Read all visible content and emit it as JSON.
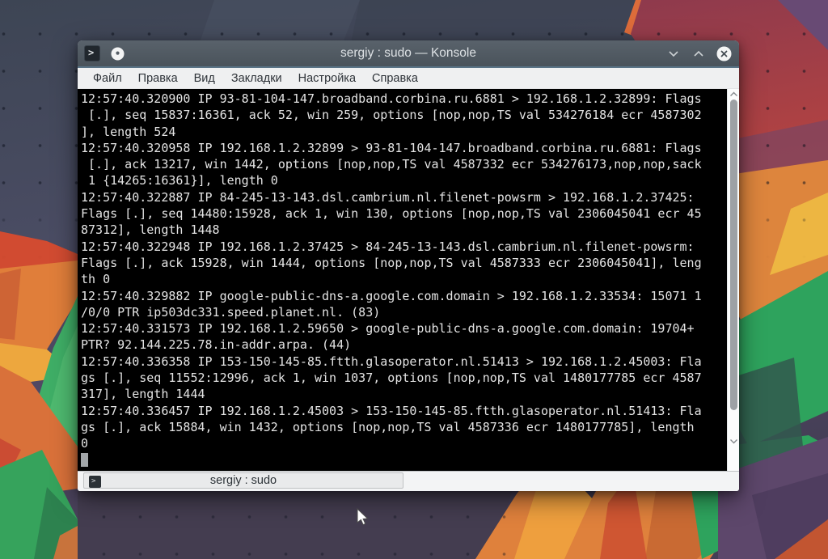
{
  "titlebar": {
    "title": "sergiy : sudo — Konsole"
  },
  "menubar": {
    "items": [
      "Файл",
      "Правка",
      "Вид",
      "Закладки",
      "Настройка",
      "Справка"
    ]
  },
  "terminal": {
    "lines": [
      "12:57:40.320900 IP 93-81-104-147.broadband.corbina.ru.6881 > 192.168.1.2.32899: Flags",
      " [.], seq 15837:16361, ack 52, win 259, options [nop,nop,TS val 534276184 ecr 4587302",
      "], length 524",
      "12:57:40.320958 IP 192.168.1.2.32899 > 93-81-104-147.broadband.corbina.ru.6881: Flags",
      " [.], ack 13217, win 1442, options [nop,nop,TS val 4587332 ecr 534276173,nop,nop,sack",
      " 1 {14265:16361}], length 0",
      "12:57:40.322887 IP 84-245-13-143.dsl.cambrium.nl.filenet-powsrm > 192.168.1.2.37425:",
      "Flags [.], seq 14480:15928, ack 1, win 130, options [nop,nop,TS val 2306045041 ecr 45",
      "87312], length 1448",
      "12:57:40.322948 IP 192.168.1.2.37425 > 84-245-13-143.dsl.cambrium.nl.filenet-powsrm:",
      "Flags [.], ack 15928, win 1444, options [nop,nop,TS val 4587333 ecr 2306045041], leng",
      "th 0",
      "12:57:40.329882 IP google-public-dns-a.google.com.domain > 192.168.1.2.33534: 15071 1",
      "/0/0 PTR ip503dc331.speed.planet.nl. (83)",
      "12:57:40.331573 IP 192.168.1.2.59650 > google-public-dns-a.google.com.domain: 19704+",
      "PTR? 92.144.225.78.in-addr.arpa. (44)",
      "12:57:40.336358 IP 153-150-145-85.ftth.glasoperator.nl.51413 > 192.168.1.2.45003: Fla",
      "gs [.], seq 11552:12996, ack 1, win 1037, options [nop,nop,TS val 1480177785 ecr 4587",
      "317], length 1444",
      "12:57:40.336457 IP 192.168.1.2.45003 > 153-150-145-85.ftth.glasoperator.nl.51413: Fla",
      "gs [.], ack 15884, win 1432, options [nop,nop,TS val 4587336 ecr 1480177785], length",
      "0"
    ]
  },
  "tabbar": {
    "active_tab": "sergiy : sudo"
  },
  "icons": {
    "konsole_glyph": ">",
    "tab_glyph": ">"
  },
  "colors": {
    "titlebar_bg": "#4e575f",
    "titlebar_accent": "#5a7487",
    "menubar_bg": "#eff0f1",
    "terminal_bg": "#000000",
    "terminal_fg": "#e4e4e4",
    "cursor": "#a2a6a9",
    "tabbar_bg": "#f3f4f5"
  }
}
